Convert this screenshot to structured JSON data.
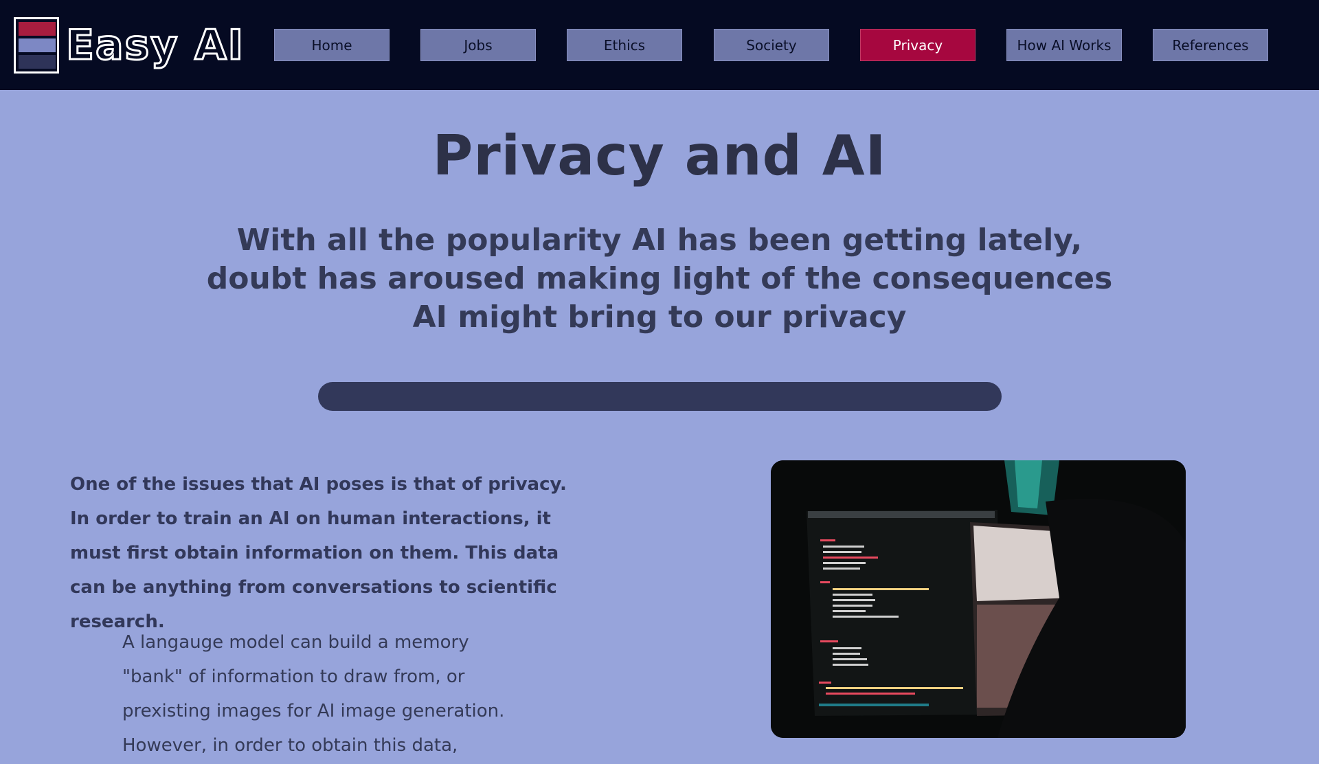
{
  "site": {
    "logo_text": "Easy AI",
    "logo_colors": [
      "#a81d3f",
      "#7d88c4",
      "#2e3358"
    ]
  },
  "nav": {
    "items": [
      {
        "label": "Home",
        "active": false
      },
      {
        "label": "Jobs",
        "active": false
      },
      {
        "label": "Ethics",
        "active": false
      },
      {
        "label": "Society",
        "active": false
      },
      {
        "label": "Privacy",
        "active": true
      },
      {
        "label": "How AI Works",
        "active": false
      },
      {
        "label": "References",
        "active": false
      }
    ]
  },
  "main": {
    "title": "Privacy and AI",
    "subtitle": "With all the popularity AI has been getting lately, doubt has aroused making light of the consequences AI might bring to our privacy",
    "paragraph1": "One of the issues that AI poses is that of privacy. In order to train an AI on human interactions, it must first obtain information on them.  This data can be anything from conversations to scientific research.",
    "paragraph2": "A langauge model can build a memory \"bank\" of information to draw from, or prexisting images for AI image generation. However, in order to obtain this data, permission must be"
  },
  "colors": {
    "page_background": "#97a4db",
    "navbar_background": "#050a22",
    "nav_button": "#6e77a8",
    "nav_active": "#a6073f",
    "text_dark": "#32385a"
  }
}
